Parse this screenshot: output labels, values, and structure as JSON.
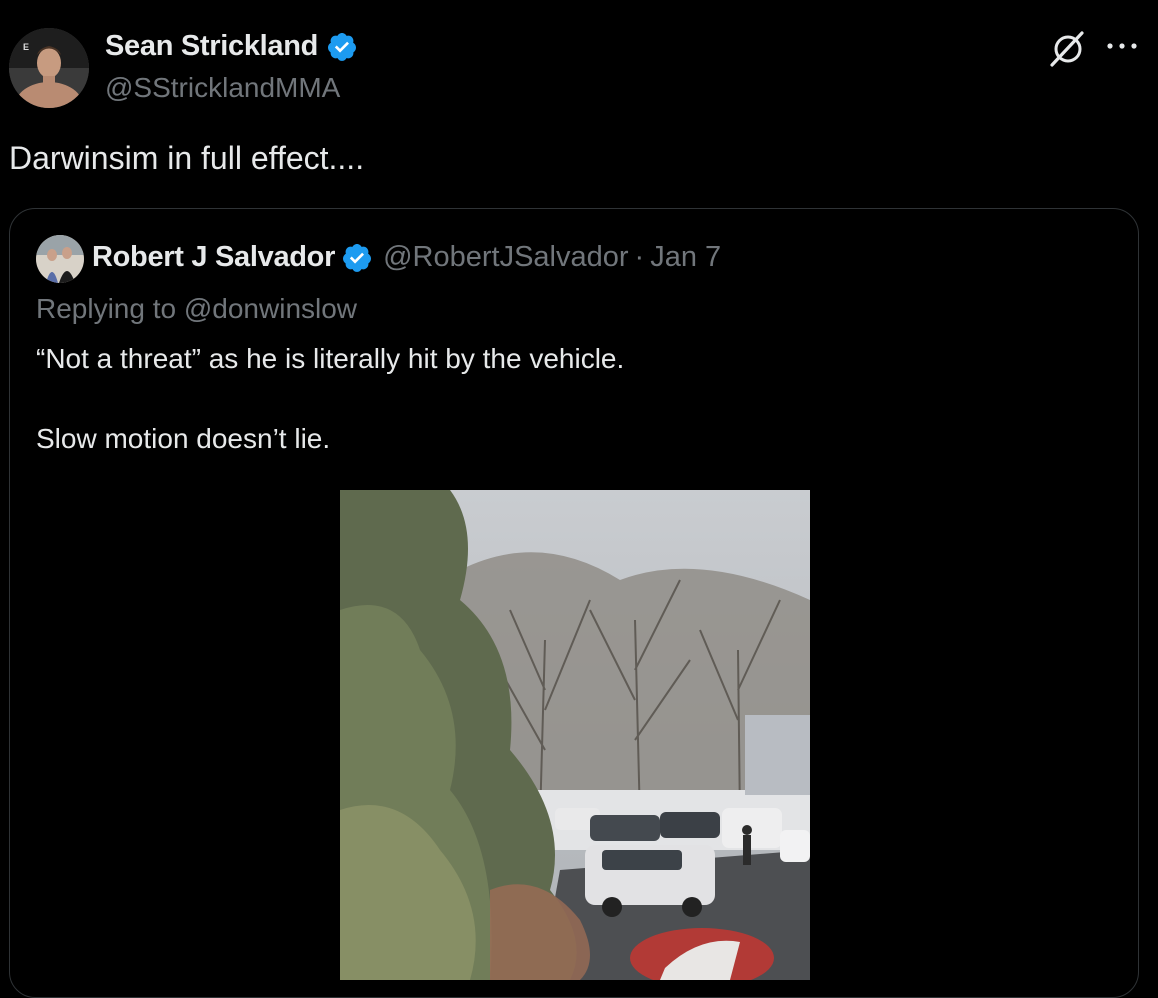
{
  "tweet": {
    "author": {
      "name": "Sean Strickland",
      "handle": "@SStricklandMMA",
      "verified": true,
      "avatar_badge": "E"
    },
    "text": "Darwinsim in full effect....",
    "icons": {
      "grok": "grok-icon",
      "more": "more-icon"
    }
  },
  "quote": {
    "author": {
      "name": "Robert J Salvador",
      "handle": "@RobertJSalvador",
      "verified": true
    },
    "separator": "·",
    "date": "Jan 7",
    "replying_to": "Replying to @donwinslow",
    "lines": [
      "“Not a threat” as he is literally hit by the vehicle.",
      "Slow motion doesn’t lie."
    ]
  },
  "colors": {
    "background": "#000000",
    "text_primary": "#e7e9ea",
    "text_secondary": "#71767b",
    "border": "#2f3336",
    "verified_blue": "#1d9bf0"
  }
}
